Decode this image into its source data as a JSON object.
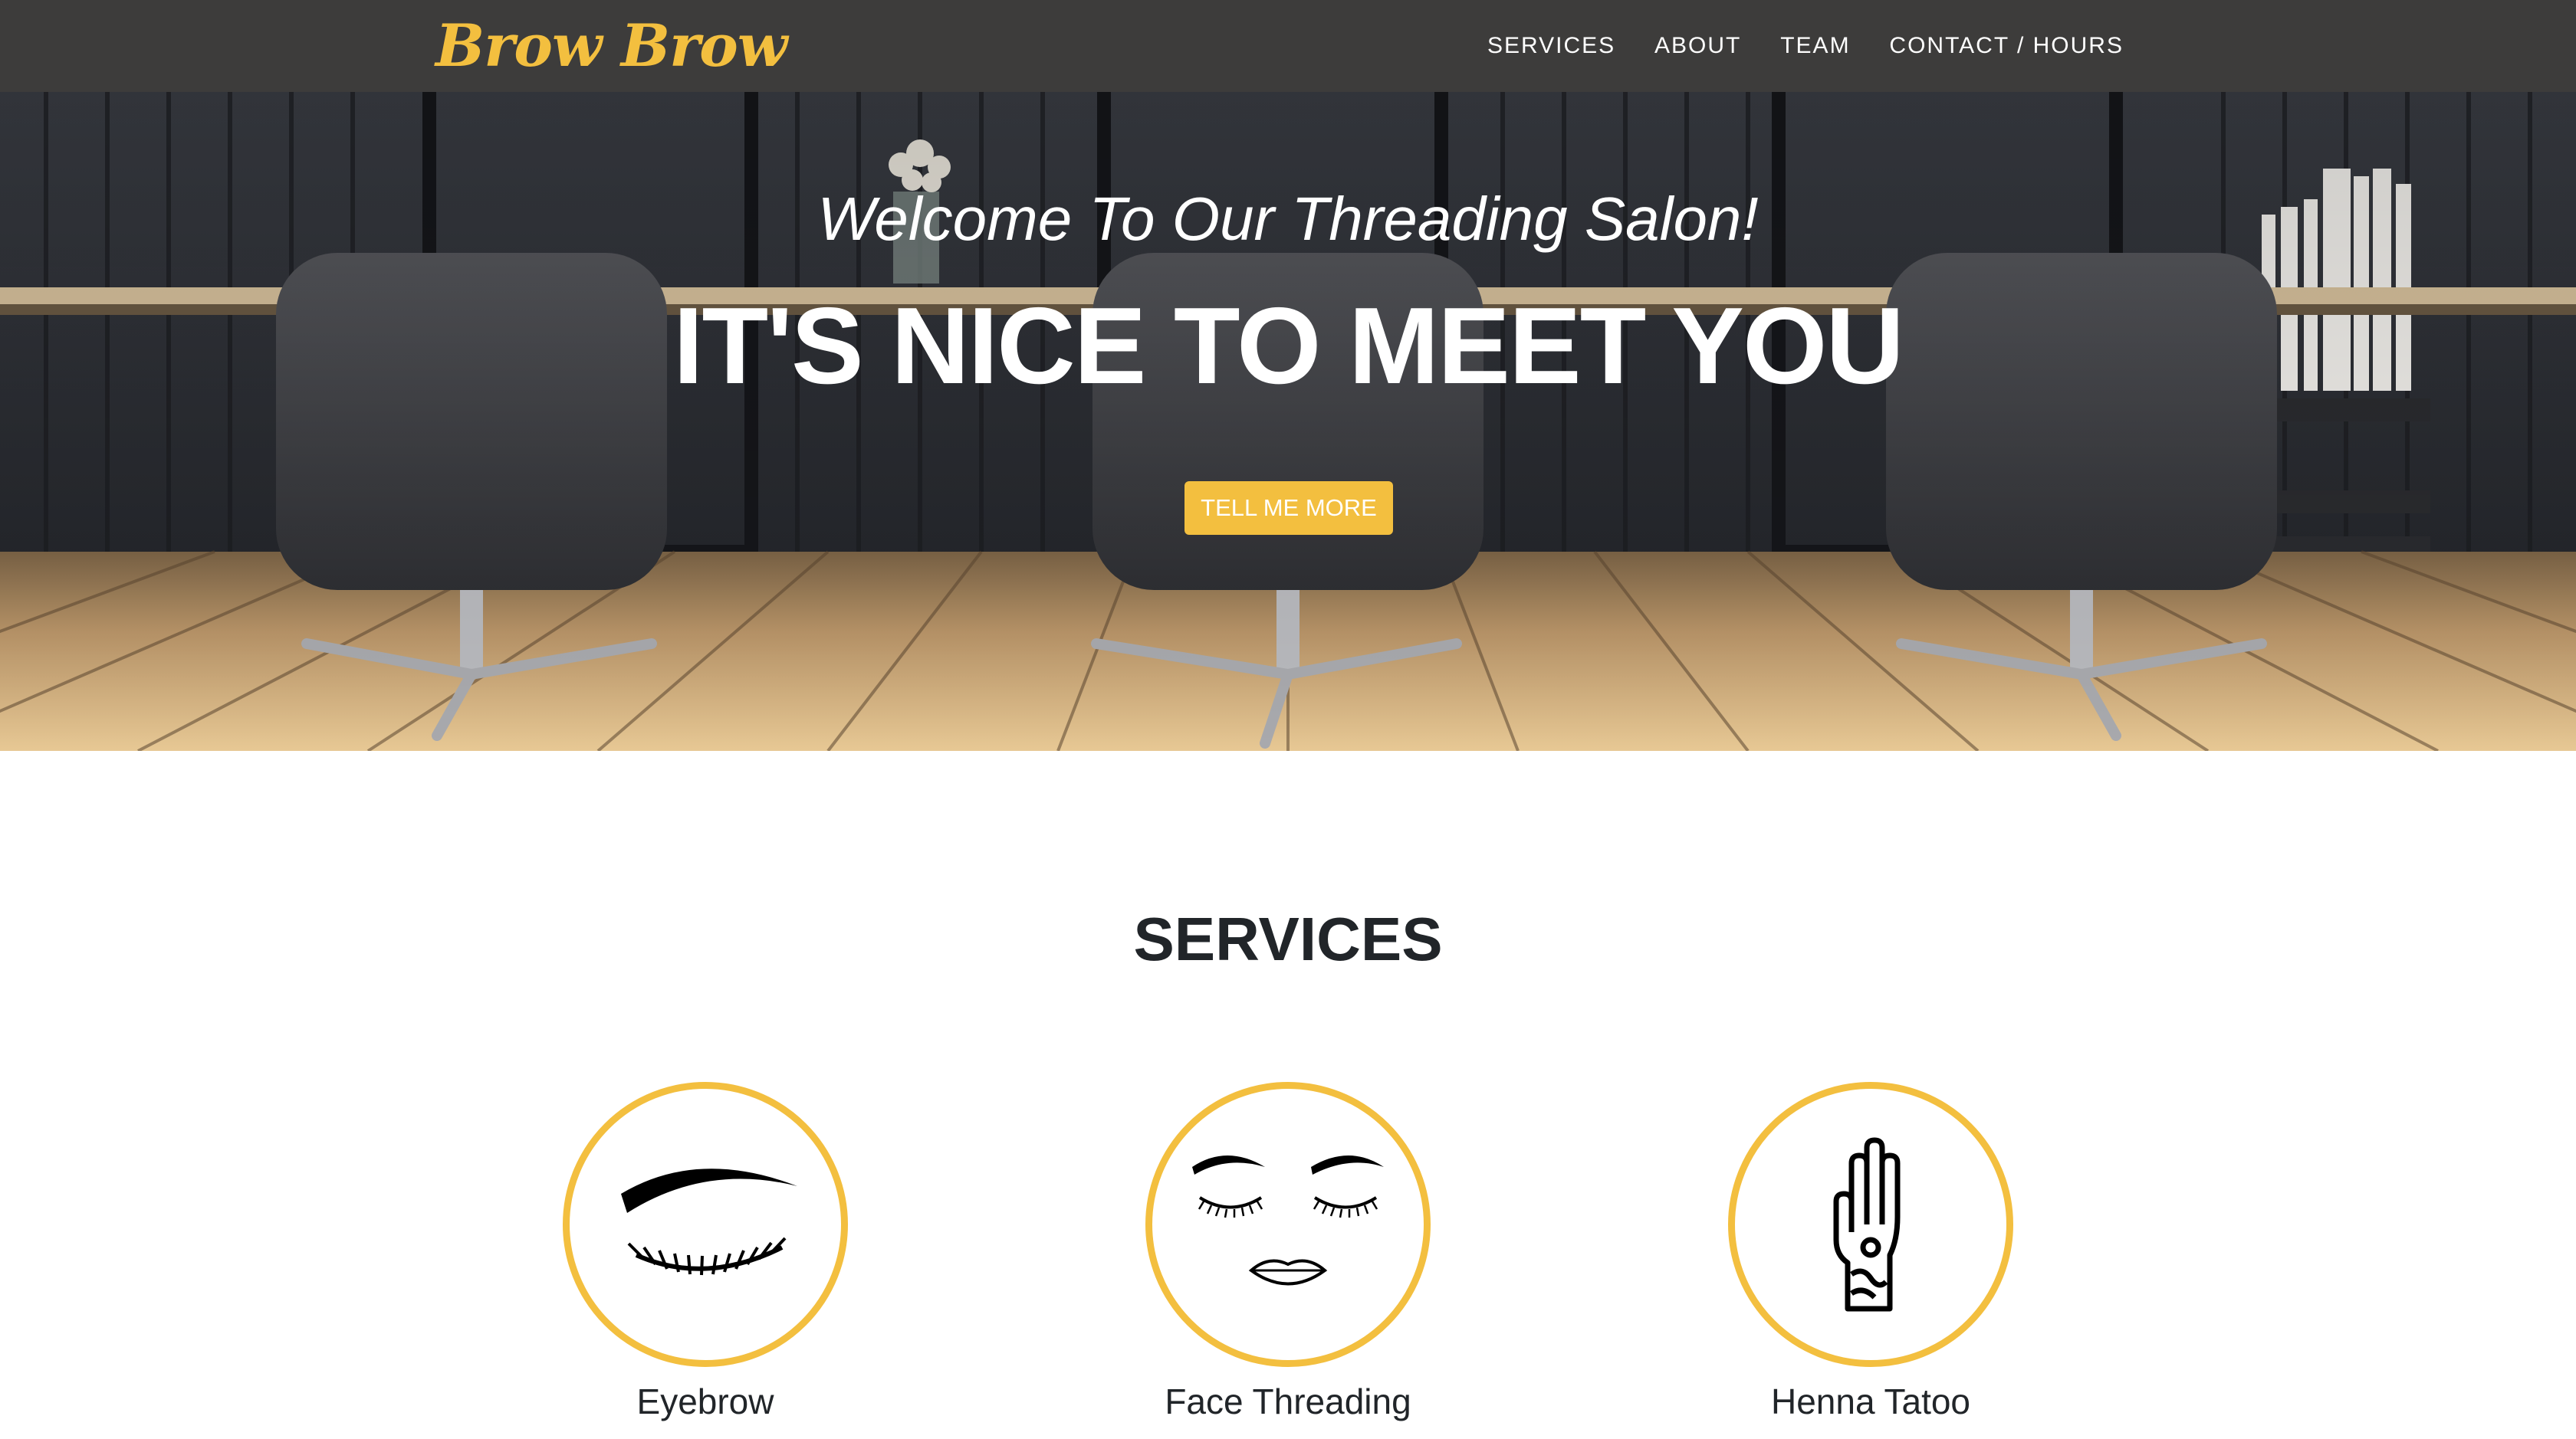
{
  "navbar": {
    "brand": "Brow Brow",
    "links": [
      "SERVICES",
      "ABOUT",
      "TEAM",
      "CONTACT / HOURS"
    ]
  },
  "hero": {
    "subheading": "Welcome To Our Threading Salon!",
    "heading": "IT'S NICE TO MEET YOU",
    "button_label": "TELL ME MORE"
  },
  "services": {
    "title": "SERVICES",
    "items": [
      {
        "label": "Eyebrow",
        "icon": "eyebrow-icon"
      },
      {
        "label": "Face Threading",
        "icon": "face-icon"
      },
      {
        "label": "Henna Tatoo",
        "icon": "henna-hand-icon"
      }
    ]
  },
  "colors": {
    "accent": "#f3bf3f",
    "navbar": "#3d3c3b",
    "text_dark": "#212529"
  }
}
